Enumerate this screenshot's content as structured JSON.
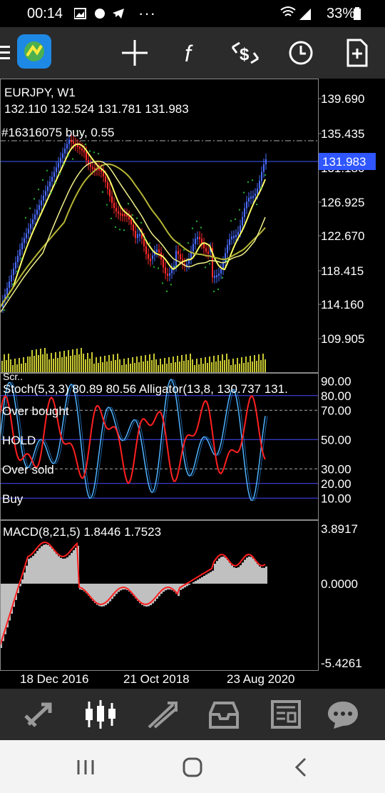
{
  "status": {
    "time": "00:14",
    "battery": "33%",
    "more": "···"
  },
  "toolbar": {
    "icons": [
      "menu-icon",
      "metatrader-logo-icon",
      "crosshair-icon",
      "indicators-icon",
      "objects-icon",
      "timeframe-icon",
      "new-order-icon"
    ]
  },
  "main": {
    "symbol": "EURJPY, W1",
    "ohlc": "132.110 132.524 131.781 131.983",
    "order_label": "#16316075 buy, 0.55",
    "price_axis": [
      "139.690",
      "135.435",
      "131.180",
      "126.925",
      "122.670",
      "118.415",
      "114.160",
      "109.905"
    ],
    "current_price": "131.983",
    "volume_label": "Scr.."
  },
  "stoch": {
    "label": "Stoch(5,3,3) 80.89 80.56 Alligator(13,8, 130.737 131.",
    "levels": [
      "90.00",
      "80.00",
      "70.00",
      "50.00",
      "30.00",
      "20.00",
      "10.00"
    ],
    "level_labels": {
      "over_bought": "Over bought",
      "hold": "HOLD",
      "over_sold": "Over sold",
      "buy": "Buy"
    }
  },
  "macd": {
    "label": "MACD(8,21,5) 1.8446 1.7523",
    "levels": [
      "3.8917",
      "0.0000",
      "-5.4261"
    ]
  },
  "time_axis": [
    "18 Dec 2016",
    "21 Oct 2018",
    "23 Aug 2020"
  ],
  "tabbar": {
    "icons": [
      "quotes-icon",
      "chart-icon",
      "trade-icon",
      "history-icon",
      "news-icon",
      "messages-icon"
    ],
    "active": "chart-icon"
  },
  "navbar": {
    "icons": [
      "recent-apps-icon",
      "home-icon",
      "back-icon"
    ]
  },
  "colors": {
    "bull": "#4a6cff",
    "bear": "#ff2b2b",
    "ma_fast": "#ffff66",
    "ma_slow": "#b5b536",
    "psar": "#22aa33",
    "volume": "#c8c832",
    "stoch_main": "#4fb3ff",
    "stoch_signal": "#ff2020",
    "histogram": "#c0c0c0",
    "level_line": "#4a4aff"
  }
}
